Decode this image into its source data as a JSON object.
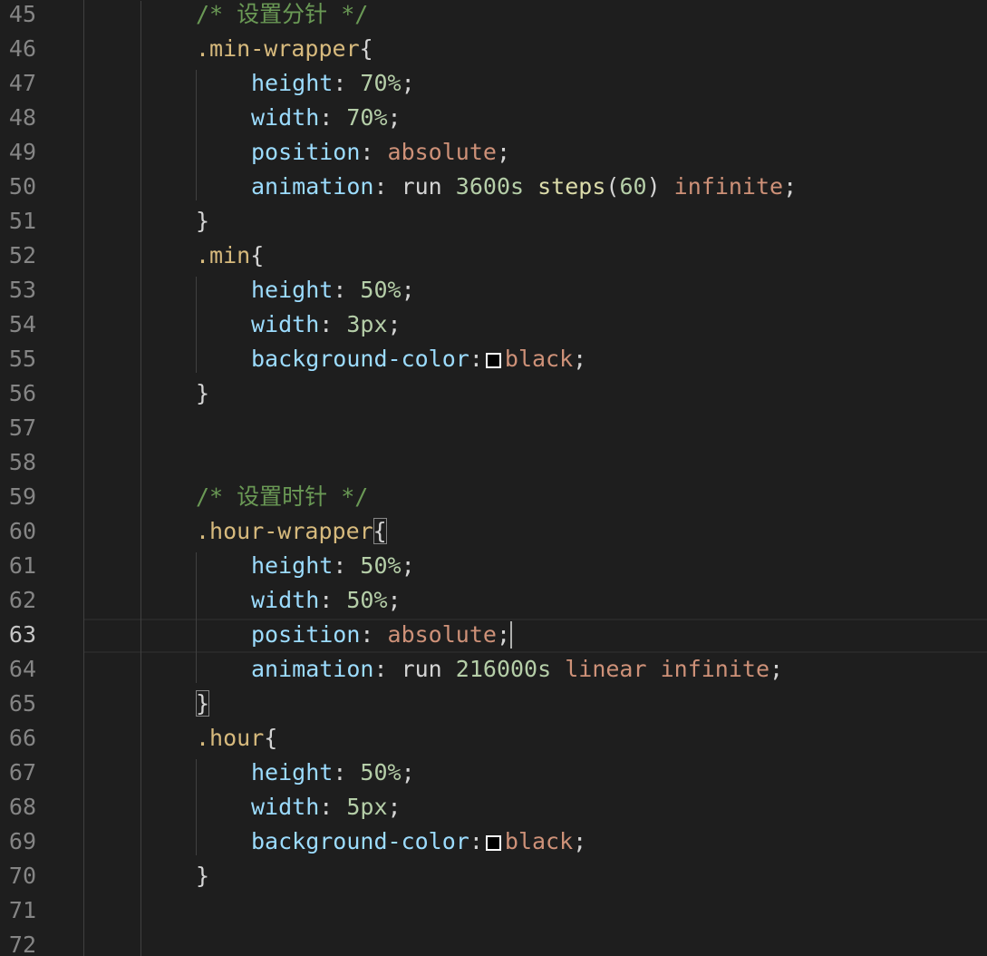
{
  "editor": {
    "active_line": 63,
    "lines": [
      {
        "num": "45",
        "tokens": [
          {
            "t": "comment",
            "v": "/* 设置分针 */"
          }
        ]
      },
      {
        "num": "46",
        "tokens": [
          {
            "t": "selector",
            "v": ".min-wrapper"
          },
          {
            "t": "brace",
            "v": "{"
          }
        ]
      },
      {
        "num": "47",
        "tokens": [
          {
            "t": "prop",
            "v": "height"
          },
          {
            "t": "punct",
            "v": ": "
          },
          {
            "t": "num",
            "v": "70%"
          },
          {
            "t": "punct",
            "v": ";"
          }
        ]
      },
      {
        "num": "48",
        "tokens": [
          {
            "t": "prop",
            "v": "width"
          },
          {
            "t": "punct",
            "v": ": "
          },
          {
            "t": "num",
            "v": "70%"
          },
          {
            "t": "punct",
            "v": ";"
          }
        ]
      },
      {
        "num": "49",
        "tokens": [
          {
            "t": "prop",
            "v": "position"
          },
          {
            "t": "punct",
            "v": ": "
          },
          {
            "t": "kw",
            "v": "absolute"
          },
          {
            "t": "punct",
            "v": ";"
          }
        ]
      },
      {
        "num": "50",
        "tokens": [
          {
            "t": "prop",
            "v": "animation"
          },
          {
            "t": "punct",
            "v": ": "
          },
          {
            "t": "plain",
            "v": "run "
          },
          {
            "t": "num",
            "v": "3600s"
          },
          {
            "t": "plain",
            "v": " "
          },
          {
            "t": "fn",
            "v": "steps"
          },
          {
            "t": "punct",
            "v": "("
          },
          {
            "t": "num",
            "v": "60"
          },
          {
            "t": "punct",
            "v": ") "
          },
          {
            "t": "kw",
            "v": "infinite"
          },
          {
            "t": "punct",
            "v": ";"
          }
        ]
      },
      {
        "num": "51",
        "tokens": [
          {
            "t": "brace",
            "v": "}"
          }
        ]
      },
      {
        "num": "52",
        "tokens": [
          {
            "t": "selector",
            "v": ".min"
          },
          {
            "t": "brace",
            "v": "{"
          }
        ]
      },
      {
        "num": "53",
        "tokens": [
          {
            "t": "prop",
            "v": "height"
          },
          {
            "t": "punct",
            "v": ": "
          },
          {
            "t": "num",
            "v": "50%"
          },
          {
            "t": "punct",
            "v": ";"
          }
        ]
      },
      {
        "num": "54",
        "tokens": [
          {
            "t": "prop",
            "v": "width"
          },
          {
            "t": "punct",
            "v": ": "
          },
          {
            "t": "num",
            "v": "3px"
          },
          {
            "t": "punct",
            "v": ";"
          }
        ]
      },
      {
        "num": "55",
        "tokens": [
          {
            "t": "prop",
            "v": "background-color"
          },
          {
            "t": "punct",
            "v": ":"
          },
          {
            "t": "swatch",
            "v": "#000000"
          },
          {
            "t": "kw",
            "v": "black"
          },
          {
            "t": "punct",
            "v": ";"
          }
        ]
      },
      {
        "num": "56",
        "tokens": [
          {
            "t": "brace",
            "v": "}"
          }
        ]
      },
      {
        "num": "57",
        "tokens": []
      },
      {
        "num": "58",
        "tokens": []
      },
      {
        "num": "59",
        "tokens": [
          {
            "t": "comment",
            "v": "/* 设置时针 */"
          }
        ]
      },
      {
        "num": "60",
        "tokens": [
          {
            "t": "selector",
            "v": ".hour-wrapper"
          },
          {
            "t": "brace-match",
            "v": "{"
          }
        ]
      },
      {
        "num": "61",
        "tokens": [
          {
            "t": "prop",
            "v": "height"
          },
          {
            "t": "punct",
            "v": ": "
          },
          {
            "t": "num",
            "v": "50%"
          },
          {
            "t": "punct",
            "v": ";"
          }
        ]
      },
      {
        "num": "62",
        "tokens": [
          {
            "t": "prop",
            "v": "width"
          },
          {
            "t": "punct",
            "v": ": "
          },
          {
            "t": "num",
            "v": "50%"
          },
          {
            "t": "punct",
            "v": ";"
          }
        ]
      },
      {
        "num": "63",
        "tokens": [
          {
            "t": "prop",
            "v": "position"
          },
          {
            "t": "punct",
            "v": ": "
          },
          {
            "t": "kw",
            "v": "absolute"
          },
          {
            "t": "punct",
            "v": ";"
          },
          {
            "t": "caret",
            "v": ""
          }
        ]
      },
      {
        "num": "64",
        "tokens": [
          {
            "t": "prop",
            "v": "animation"
          },
          {
            "t": "punct",
            "v": ": "
          },
          {
            "t": "plain",
            "v": "run "
          },
          {
            "t": "num",
            "v": "216000s"
          },
          {
            "t": "plain",
            "v": " "
          },
          {
            "t": "kw",
            "v": "linear"
          },
          {
            "t": "plain",
            "v": " "
          },
          {
            "t": "kw",
            "v": "infinite"
          },
          {
            "t": "punct",
            "v": ";"
          }
        ]
      },
      {
        "num": "65",
        "tokens": [
          {
            "t": "brace-match",
            "v": "}"
          }
        ]
      },
      {
        "num": "66",
        "tokens": [
          {
            "t": "selector",
            "v": ".hour"
          },
          {
            "t": "brace",
            "v": "{"
          }
        ]
      },
      {
        "num": "67",
        "tokens": [
          {
            "t": "prop",
            "v": "height"
          },
          {
            "t": "punct",
            "v": ": "
          },
          {
            "t": "num",
            "v": "50%"
          },
          {
            "t": "punct",
            "v": ";"
          }
        ]
      },
      {
        "num": "68",
        "tokens": [
          {
            "t": "prop",
            "v": "width"
          },
          {
            "t": "punct",
            "v": ": "
          },
          {
            "t": "num",
            "v": "5px"
          },
          {
            "t": "punct",
            "v": ";"
          }
        ]
      },
      {
        "num": "69",
        "tokens": [
          {
            "t": "prop",
            "v": "background-color"
          },
          {
            "t": "punct",
            "v": ":"
          },
          {
            "t": "swatch",
            "v": "#000000"
          },
          {
            "t": "kw",
            "v": "black"
          },
          {
            "t": "punct",
            "v": ";"
          }
        ]
      },
      {
        "num": "70",
        "tokens": [
          {
            "t": "brace",
            "v": "}"
          }
        ]
      },
      {
        "num": "71",
        "tokens": []
      },
      {
        "num": "72",
        "tokens": []
      }
    ]
  }
}
